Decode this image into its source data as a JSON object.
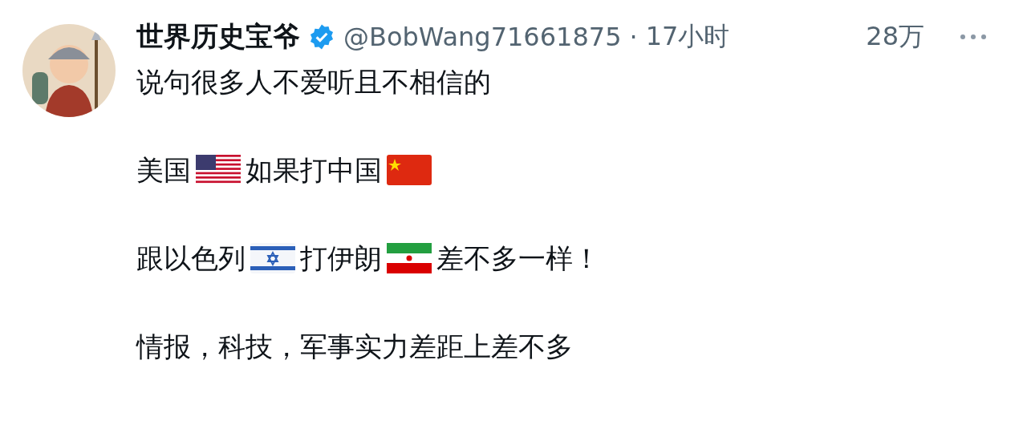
{
  "post": {
    "author": {
      "name": "世界历史宝爷",
      "verified": true,
      "handle": "@BobWang71661875",
      "separator": "·",
      "time": "17小时"
    },
    "views": "28万",
    "paragraphs": [
      {
        "segments": [
          {
            "kind": "text",
            "text": "说句很多人不爱听且不相信的"
          }
        ]
      },
      {
        "segments": [
          {
            "kind": "text",
            "text": "美国"
          },
          {
            "kind": "flag_us"
          },
          {
            "kind": "text",
            "text": "如果打中国"
          },
          {
            "kind": "flag_cn"
          }
        ]
      },
      {
        "segments": [
          {
            "kind": "text",
            "text": "跟以色列"
          },
          {
            "kind": "flag_il"
          },
          {
            "kind": "text",
            "text": "打伊朗"
          },
          {
            "kind": "flag_ir"
          },
          {
            "kind": "text",
            "text": "差不多一样！"
          }
        ]
      },
      {
        "segments": [
          {
            "kind": "text",
            "text": "情报，科技，军事实力差距上差不多"
          }
        ]
      }
    ]
  }
}
